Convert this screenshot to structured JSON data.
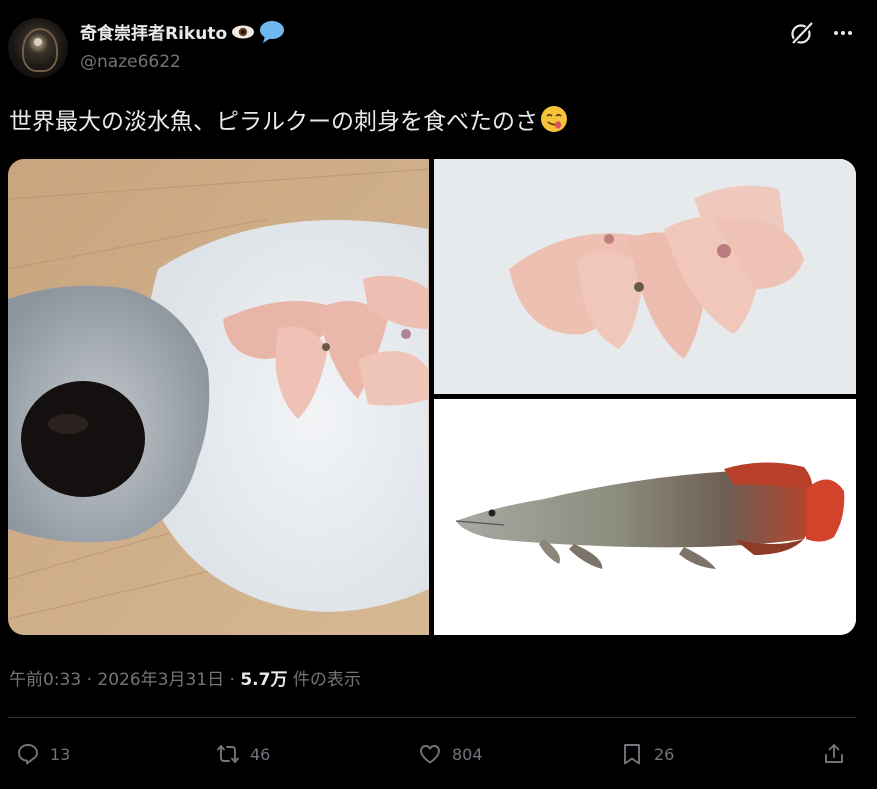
{
  "post": {
    "author_name": "奇食崇拝者Rikuto",
    "author_handle": "@naze6622",
    "text": "世界最大の淡水魚、ピラルクーの刺身を食べたのさ",
    "timestamp": "午前0:33 · 2026年3月31日",
    "view_count": "5.7万",
    "view_label": "件の表示",
    "separator": " · "
  },
  "actions": {
    "replies": "13",
    "reposts": "46",
    "likes": "804",
    "bookmarks": "26"
  },
  "icons": {
    "grok": "grok-icon",
    "more": "more-icon",
    "reply": "reply-icon",
    "repost": "repost-icon",
    "like": "heart-icon",
    "bookmark": "bookmark-icon",
    "share": "share-icon"
  },
  "colors": {
    "background": "#000000",
    "text_primary": "#e7e9ea",
    "text_secondary": "#71767b",
    "divider": "#2f3336"
  }
}
